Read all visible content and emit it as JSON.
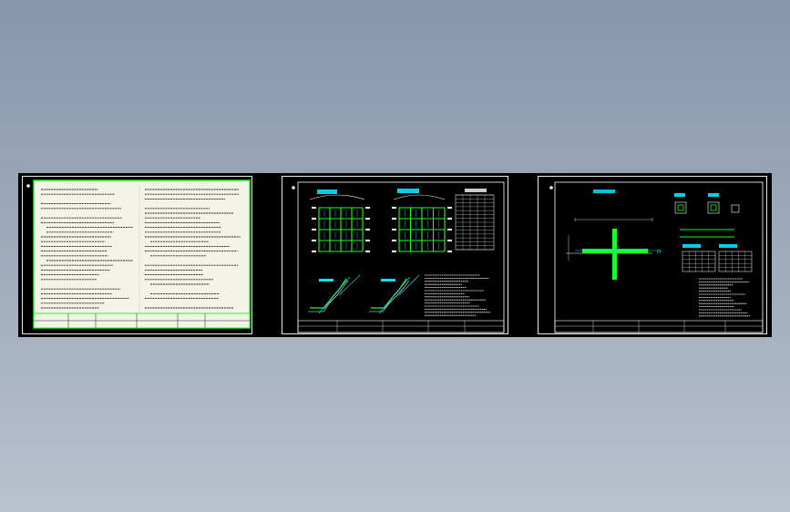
{
  "colors": {
    "background_top": "#8797ab",
    "background_bottom": "#b9c2ce",
    "sheet_background": "#000000",
    "border": "#e8e8e8",
    "drawing_green": "#1aff1a",
    "drawing_cyan": "#00e5ff",
    "drawing_white": "#ffffff",
    "paper_fill": "#f3f3e7"
  },
  "sheets": [
    {
      "name": "sheet-1-specification-text"
    },
    {
      "name": "sheet-2-reinforcement-plans"
    },
    {
      "name": "sheet-3-joint-detail"
    }
  ]
}
